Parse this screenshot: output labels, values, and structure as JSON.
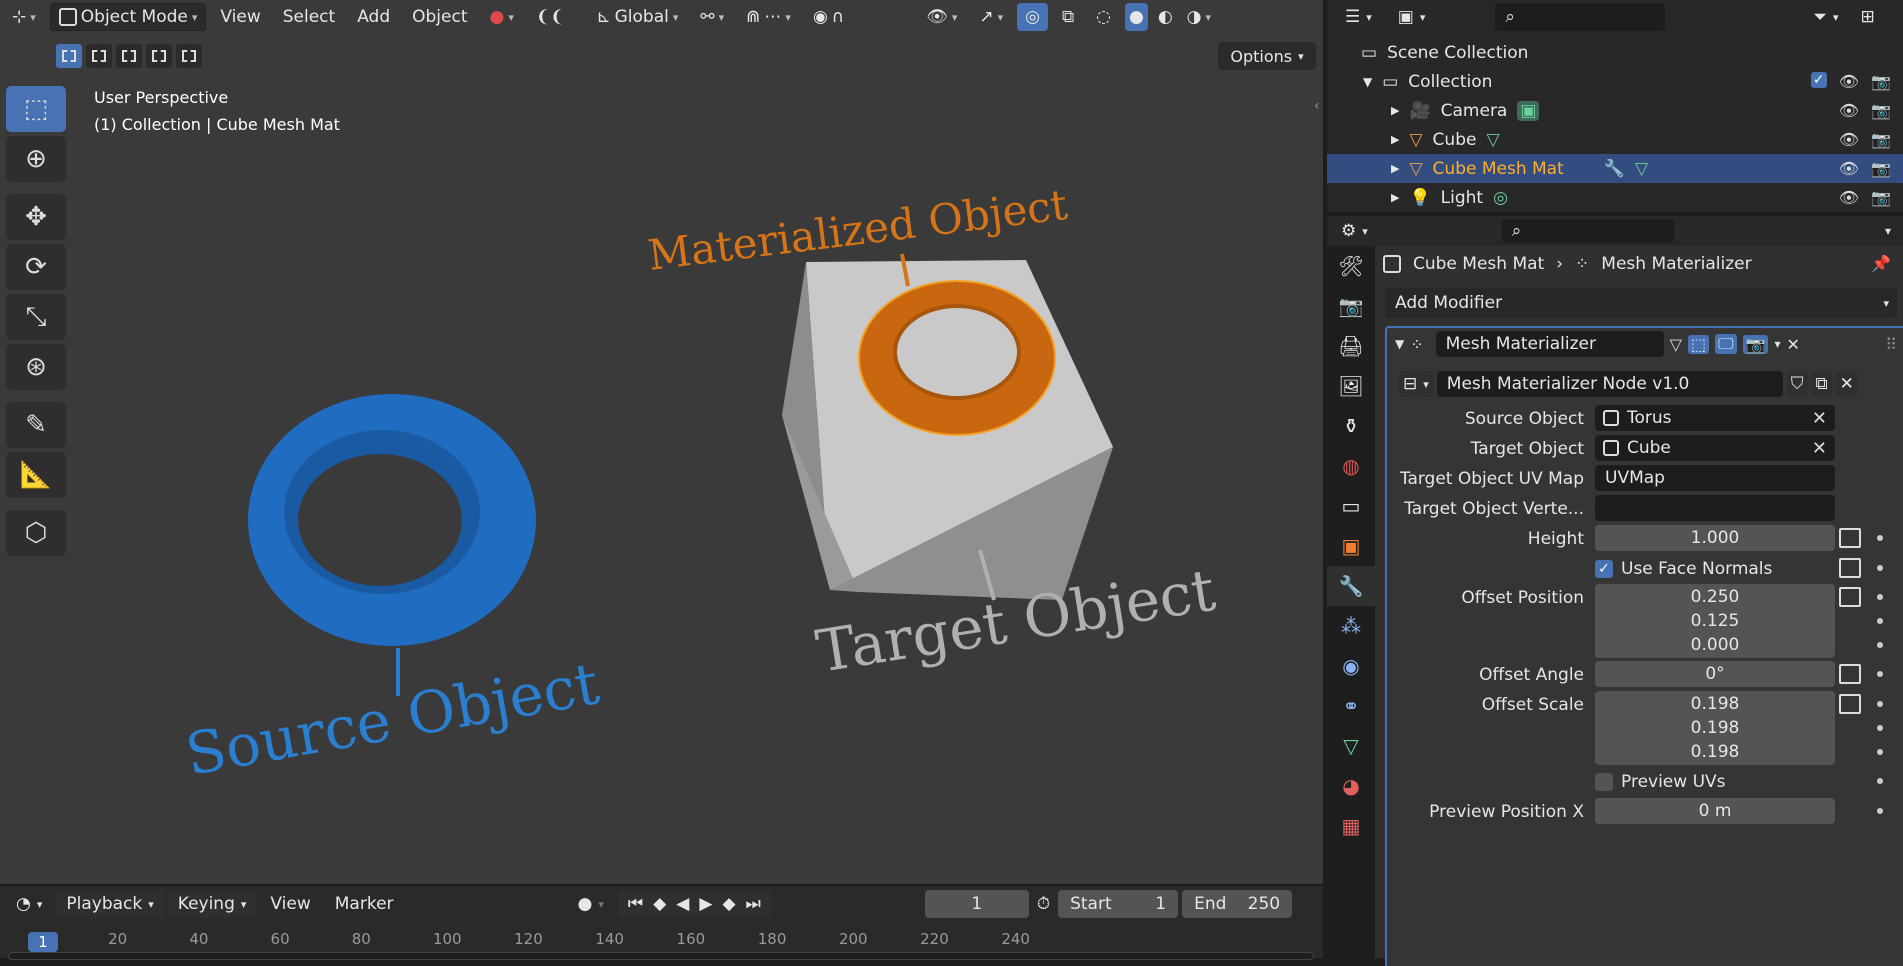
{
  "viewport": {
    "header": {
      "mode": "Object Mode",
      "menus": [
        "View",
        "Select",
        "Add",
        "Object"
      ],
      "orientation": "Global"
    },
    "options_label": "Options",
    "overlay_text": {
      "perspective": "User Perspective",
      "context": "(1) Collection | Cube Mesh Mat"
    },
    "scene_labels": {
      "materialized": "Materialized Object",
      "target": "Target Object",
      "source": "Source Object"
    },
    "colors": {
      "background": "#3a3a3a",
      "source": "#2a7fd0",
      "materialized": "#d67518",
      "target": "#b0b0b0"
    }
  },
  "timeline": {
    "menus": [
      "Playback",
      "Keying",
      "View",
      "Marker"
    ],
    "current_frame": "1",
    "start_label": "Start",
    "start_value": "1",
    "end_label": "End",
    "end_value": "250",
    "ruler_ticks": [
      "1",
      "20",
      "40",
      "60",
      "80",
      "100",
      "120",
      "140",
      "160",
      "180",
      "200",
      "220",
      "240"
    ]
  },
  "outliner": {
    "root": "Scene Collection",
    "collection": "Collection",
    "items": [
      {
        "label": "Camera",
        "icon": "camera-icon",
        "selected": false
      },
      {
        "label": "Cube",
        "icon": "mesh-icon",
        "selected": false
      },
      {
        "label": "Cube Mesh Mat",
        "icon": "mesh-icon",
        "selected": true
      },
      {
        "label": "Light",
        "icon": "light-icon",
        "selected": false
      }
    ]
  },
  "properties": {
    "breadcrumb": {
      "object": "Cube Mesh Mat",
      "modifier": "Mesh Materializer"
    },
    "add_modifier": "Add Modifier",
    "modifier_name": "Mesh Materializer",
    "node_group": "Mesh Materializer Node v1.0",
    "fields": {
      "source_object_label": "Source Object",
      "source_object_value": "Torus",
      "target_object_label": "Target Object",
      "target_object_value": "Cube",
      "uv_map_label": "Target Object UV Map",
      "uv_map_value": "UVMap",
      "vert_label": "Target Object Verte...",
      "vert_value": "",
      "height_label": "Height",
      "height_value": "1.000",
      "use_face_normals_label": "Use Face Normals",
      "offset_position_label": "Offset Position",
      "offset_position_values": [
        "0.250",
        "0.125",
        "0.000"
      ],
      "offset_angle_label": "Offset Angle",
      "offset_angle_value": "0°",
      "offset_scale_label": "Offset Scale",
      "offset_scale_values": [
        "0.198",
        "0.198",
        "0.198"
      ],
      "preview_uvs_label": "Preview UVs",
      "preview_pos_x_label": "Preview Position X",
      "preview_pos_x_value": "0 m"
    },
    "use_face_normals": true,
    "preview_uvs": false,
    "accent": "#4772b3"
  }
}
